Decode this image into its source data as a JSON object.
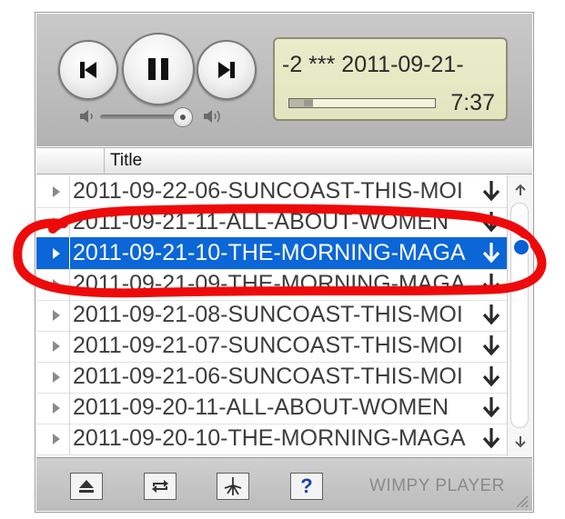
{
  "display": {
    "track_text": "-2 ***  2011-09-21-",
    "time": "7:37",
    "seek_progress": 0.16
  },
  "playlist": {
    "column_header": "Title",
    "rows": [
      {
        "title": "2011-09-22-06-SUNCOAST-THIS-MOI",
        "selected": false
      },
      {
        "title": "2011-09-21-11-ALL-ABOUT-WOMEN",
        "selected": false
      },
      {
        "title": "2011-09-21-10-THE-MORNING-MAGA",
        "selected": true
      },
      {
        "title": "2011-09-21-09-THE-MORNING-MAGA",
        "selected": false
      },
      {
        "title": "2011-09-21-08-SUNCOAST-THIS-MOI",
        "selected": false
      },
      {
        "title": "2011-09-21-07-SUNCOAST-THIS-MOI",
        "selected": false
      },
      {
        "title": "2011-09-21-06-SUNCOAST-THIS-MOI",
        "selected": false
      },
      {
        "title": "2011-09-20-11-ALL-ABOUT-WOMEN",
        "selected": false
      },
      {
        "title": "2011-09-20-10-THE-MORNING-MAGA",
        "selected": false
      }
    ]
  },
  "toolbar": {
    "help_label": "?",
    "brand": "WIMPY PLAYER"
  },
  "colors": {
    "selection": "#0b66d8",
    "annotation": "#ee0a0a",
    "lcd": "#e4e8c4"
  },
  "icons": {
    "prev": "skip-back-icon",
    "pause": "pause-icon",
    "next": "skip-forward-icon",
    "eject": "eject-icon",
    "repeat": "repeat-icon",
    "shuffle": "shuffle-icon",
    "download": "download-arrow-icon"
  }
}
